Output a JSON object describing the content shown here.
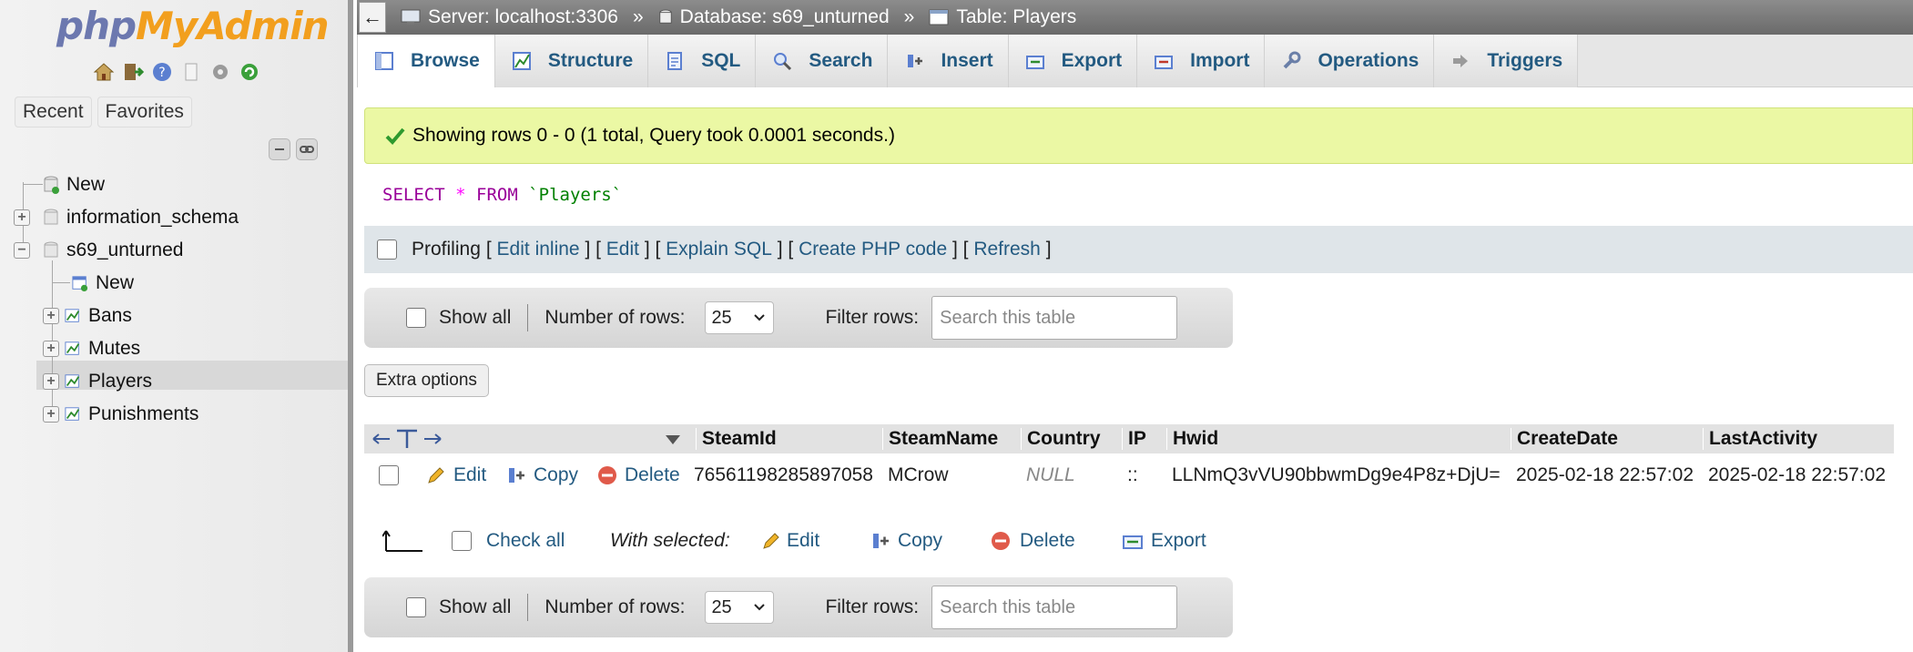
{
  "sidebar": {
    "logo": {
      "php": "php",
      "my": "My",
      "admin": "Admin"
    },
    "quick_icons": [
      "home-icon",
      "exit-icon",
      "help-icon",
      "docs-icon",
      "settings-icon",
      "reload-icon"
    ],
    "recent_label": "Recent",
    "favorites_label": "Favorites",
    "tree": {
      "new": "New",
      "information_schema": "information_schema",
      "s69_unturned": "s69_unturned",
      "db_new": "New",
      "bans": "Bans",
      "mutes": "Mutes",
      "players": "Players",
      "punishments": "Punishments"
    }
  },
  "breadcrumb": {
    "back": "←",
    "server": "Server: localhost:3306",
    "database": "Database: s69_unturned",
    "table": "Table: Players",
    "separator": "»"
  },
  "tabs": [
    "Browse",
    "Structure",
    "SQL",
    "Search",
    "Insert",
    "Export",
    "Import",
    "Operations",
    "Triggers"
  ],
  "message": "Showing rows 0 - 0 (1 total, Query took 0.0001 seconds.)",
  "sql": {
    "select": "SELECT",
    "star": "*",
    "from": "FROM",
    "table": "`Players`"
  },
  "profiling": {
    "label": "Profiling",
    "edit_inline": "Edit inline",
    "edit": "Edit",
    "explain": "Explain SQL",
    "create_php": "Create PHP code",
    "refresh": "Refresh"
  },
  "nav": {
    "show_all": "Show all",
    "num_rows_label": "Number of rows:",
    "num_rows_value": "25",
    "filter_label": "Filter rows:",
    "filter_placeholder": "Search this table"
  },
  "extra_options": "Extra options",
  "table": {
    "columns": [
      "SteamId",
      "SteamName",
      "Country",
      "IP",
      "Hwid",
      "CreateDate",
      "LastActivity"
    ],
    "row_actions": {
      "edit": "Edit",
      "copy": "Copy",
      "delete": "Delete"
    },
    "rows": [
      {
        "SteamId": "76561198285897058",
        "SteamName": "MCrow",
        "Country": "NULL",
        "IP": "::",
        "Hwid": "LLNmQ3vVU90bbwmDg9e4P8z+DjU=",
        "CreateDate": "2025-02-18 22:57:02",
        "LastActivity": "2025-02-18 22:57:02"
      }
    ]
  },
  "bulk": {
    "check_all": "Check all",
    "with_selected": "With selected:",
    "edit": "Edit",
    "copy": "Copy",
    "delete": "Delete",
    "export": "Export"
  },
  "colors": {
    "link": "#235a81",
    "success_bg": "#ebf8a4",
    "logo_php": "#6c78af",
    "logo_myadmin": "#f29f1e"
  }
}
